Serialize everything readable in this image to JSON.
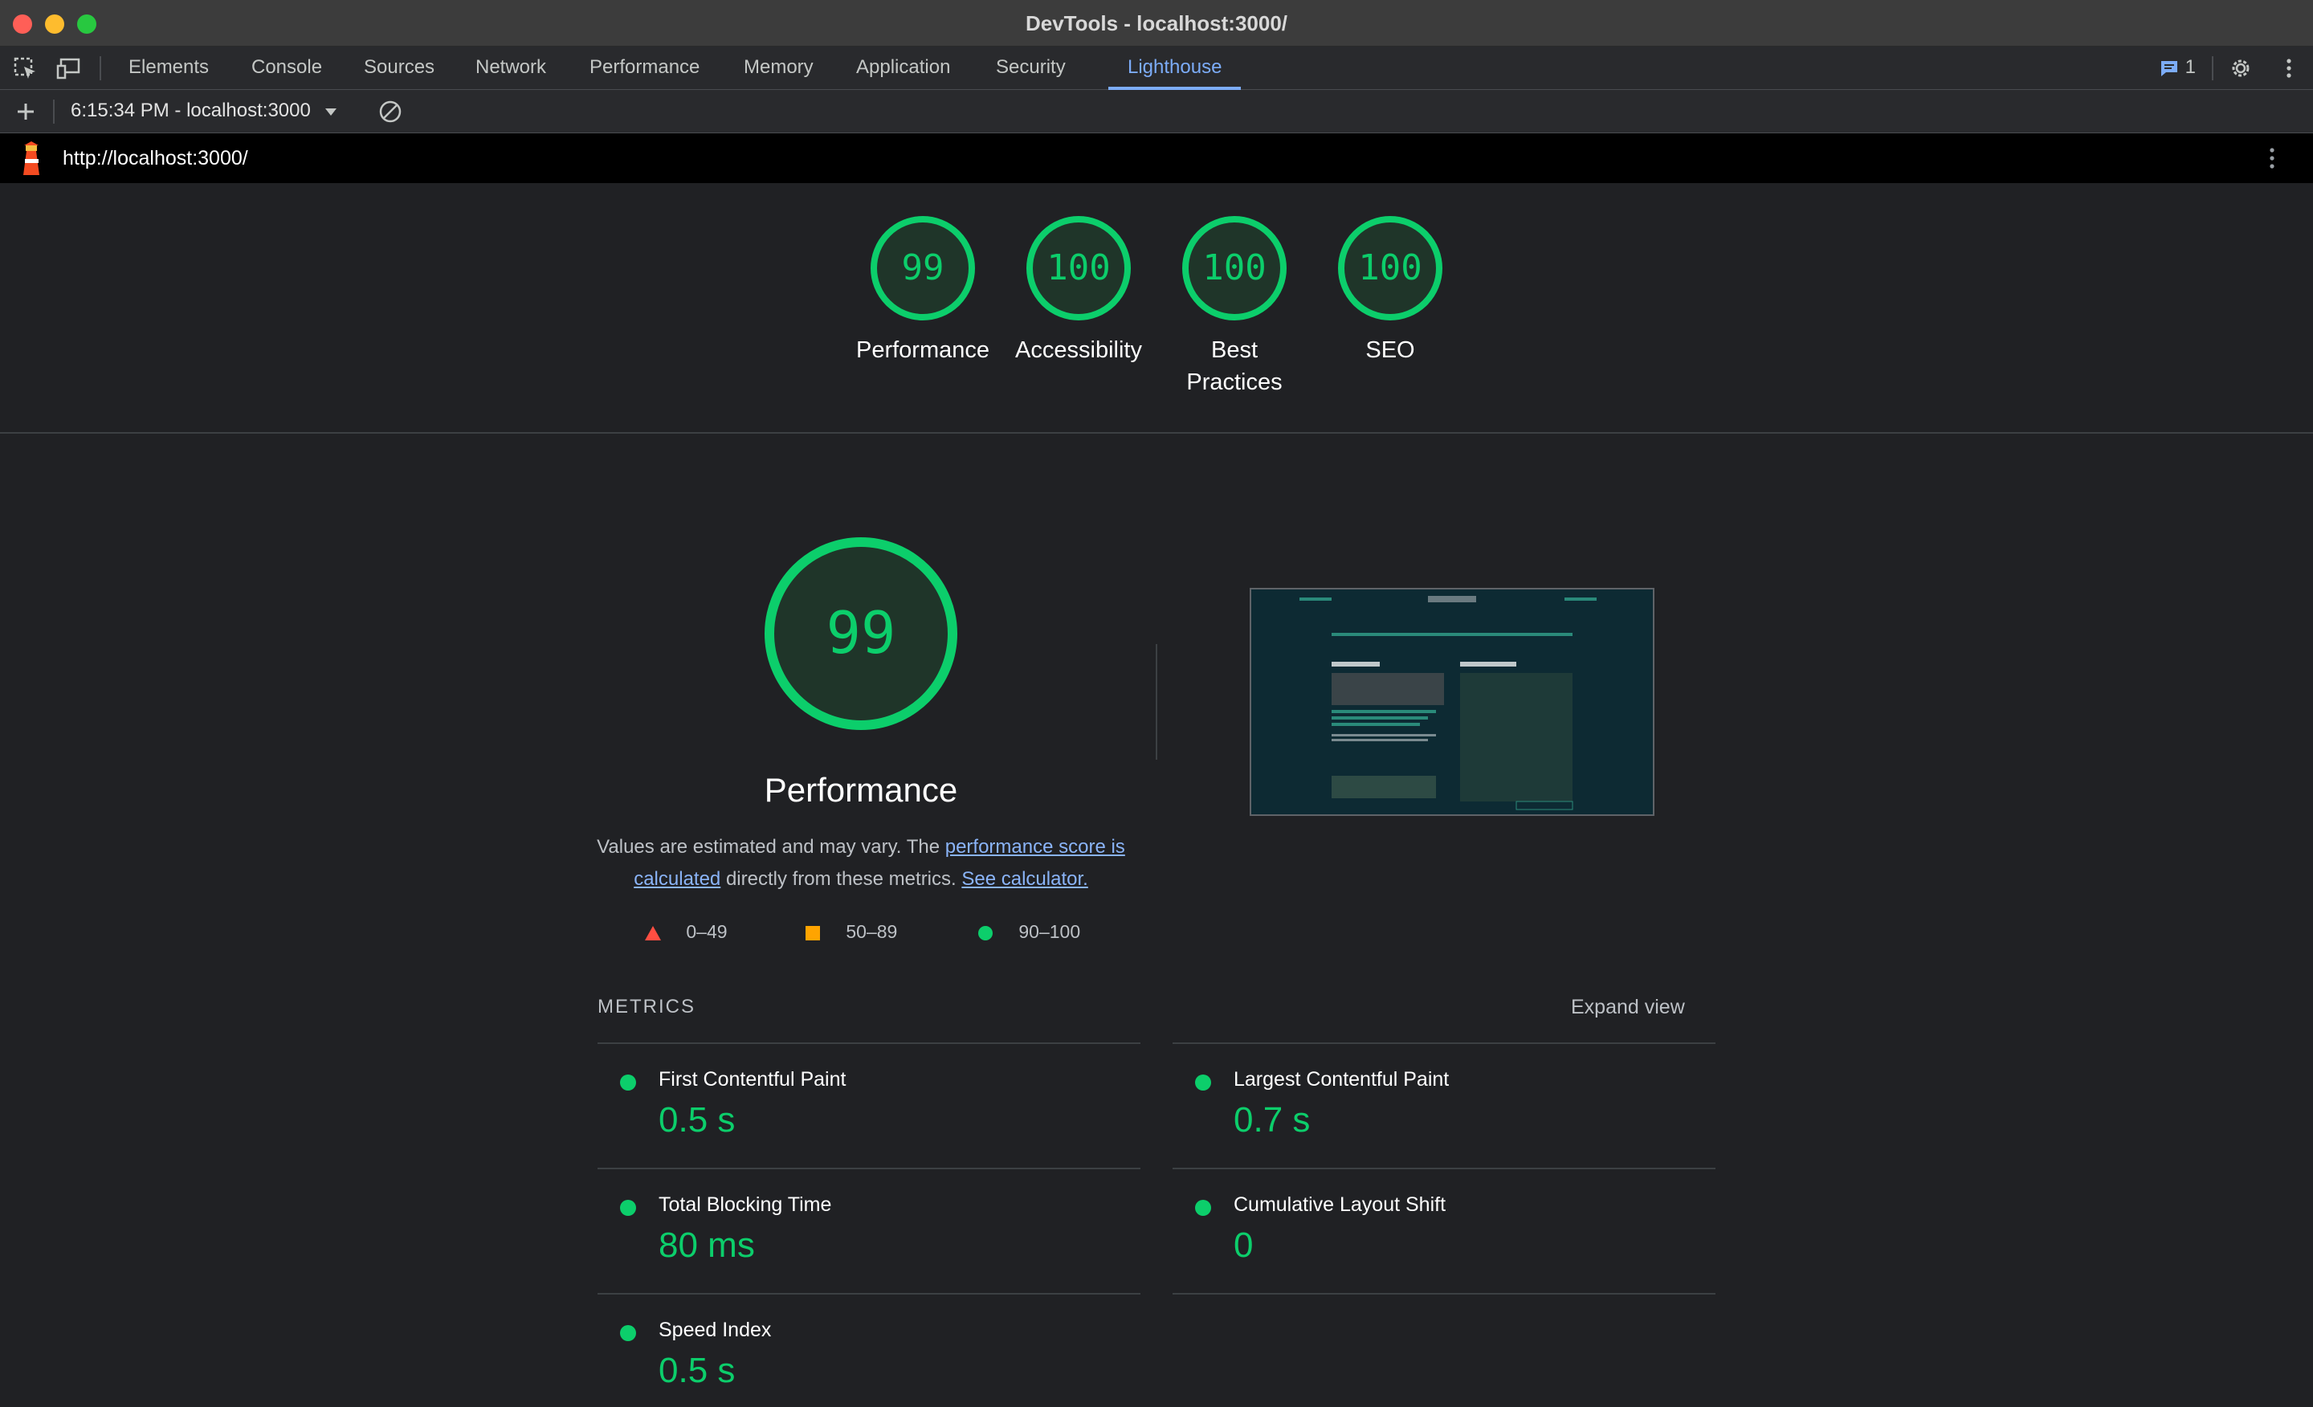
{
  "window": {
    "title": "DevTools - localhost:3000/"
  },
  "tabs": [
    "Elements",
    "Console",
    "Sources",
    "Network",
    "Performance",
    "Memory",
    "Application",
    "Security",
    "Lighthouse"
  ],
  "active_tab": "Lighthouse",
  "issues_count": "1",
  "toolbar": {
    "report_label": "6:15:34 PM - localhost:3000"
  },
  "url": "http://localhost:3000/",
  "categories": [
    {
      "score": "99",
      "label": "Performance"
    },
    {
      "score": "100",
      "label": "Accessibility"
    },
    {
      "score": "100",
      "label": "Best Practices"
    },
    {
      "score": "100",
      "label": "SEO"
    }
  ],
  "performance": {
    "score": "99",
    "title": "Performance",
    "desc_prefix": "Values are estimated and may vary. The ",
    "desc_link1": "performance score is calculated",
    "desc_middle": " directly from these metrics. ",
    "desc_link2": "See calculator."
  },
  "legend": [
    "0–49",
    "50–89",
    "90–100"
  ],
  "metrics_heading": "METRICS",
  "expand_label": "Expand view",
  "metrics": [
    {
      "name": "First Contentful Paint",
      "value": "0.5 s"
    },
    {
      "name": "Largest Contentful Paint",
      "value": "0.7 s"
    },
    {
      "name": "Total Blocking Time",
      "value": "80 ms"
    },
    {
      "name": "Cumulative Layout Shift",
      "value": "0"
    },
    {
      "name": "Speed Index",
      "value": "0.5 s"
    }
  ],
  "colors": {
    "pass": "#0cce6b",
    "average": "#ffa400",
    "fail": "#ff4e42",
    "accent": "#7cacf8"
  }
}
